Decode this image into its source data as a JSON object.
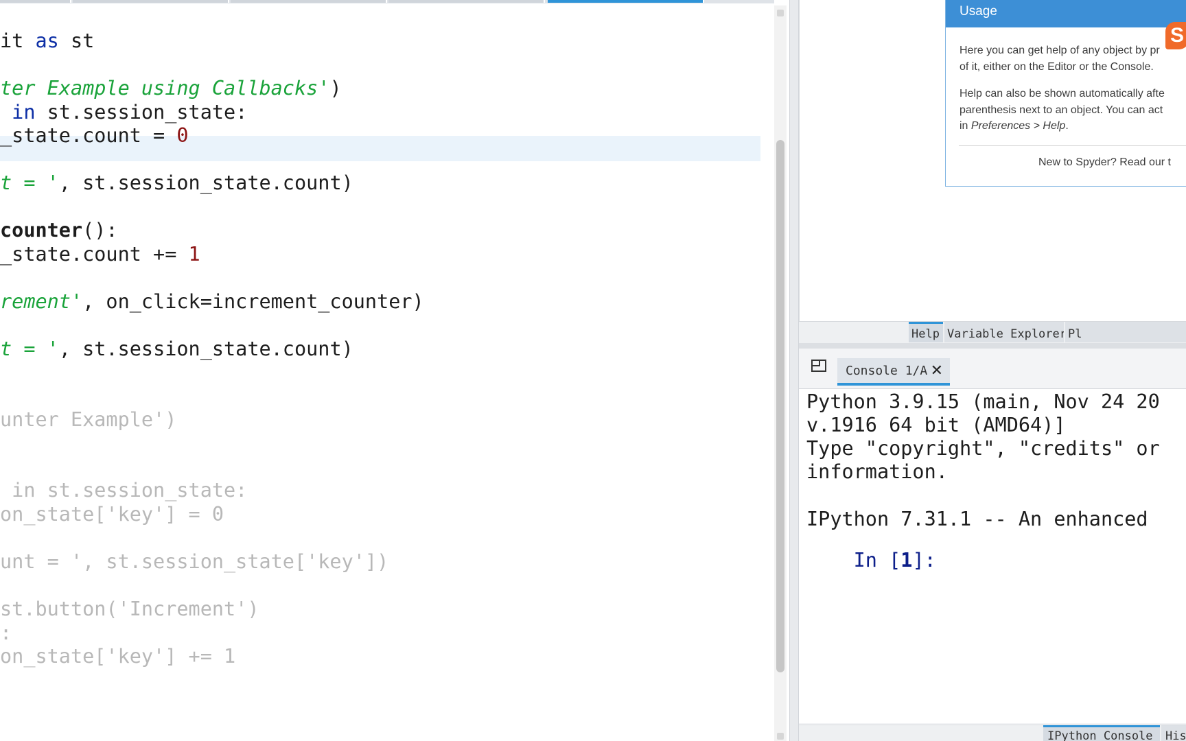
{
  "editor": {
    "lines": [
      {
        "id": "l1",
        "parts": [
          [
            "it ",
            ""
          ],
          [
            "as",
            "kw"
          ],
          [
            " st",
            ""
          ]
        ]
      },
      {
        "id": "l2",
        "parts": [
          [
            "ter Example using Callbacks'",
            "str"
          ],
          [
            ")",
            ""
          ]
        ]
      },
      {
        "id": "l3",
        "parts": [
          [
            " ",
            ""
          ],
          [
            "in",
            "kw"
          ],
          [
            " st.session_state:",
            ""
          ]
        ]
      },
      {
        "id": "l4",
        "parts": [
          [
            "_state.count = ",
            ""
          ],
          [
            "0",
            "num"
          ]
        ]
      },
      {
        "id": "l5",
        "parts": [
          [
            "t = '",
            "str"
          ],
          [
            ", st.session_state.count)",
            ""
          ]
        ]
      },
      {
        "id": "l6",
        "parts": [
          [
            "counter",
            "fn"
          ],
          [
            "():",
            ""
          ]
        ]
      },
      {
        "id": "l7",
        "parts": [
          [
            "_state.count += ",
            ""
          ],
          [
            "1",
            "num"
          ]
        ]
      },
      {
        "id": "l8",
        "parts": [
          [
            "rement'",
            "str"
          ],
          [
            ", on_click=increment_counter)",
            ""
          ]
        ]
      },
      {
        "id": "l9",
        "parts": [
          [
            "t = '",
            "str"
          ],
          [
            ", st.session_state.count)",
            ""
          ]
        ]
      },
      {
        "id": "l10",
        "parts": [
          [
            "unter Example')",
            "dim"
          ]
        ]
      },
      {
        "id": "l11",
        "parts": [
          [
            " in st.session_state:",
            "dim"
          ]
        ]
      },
      {
        "id": "l12",
        "parts": [
          [
            "on_state['key'] = 0",
            "dim"
          ]
        ]
      },
      {
        "id": "l13",
        "parts": [
          [
            "unt = ', st.session_state['key'])",
            "dim"
          ]
        ]
      },
      {
        "id": "l14",
        "parts": [
          [
            "st.button('Increment')",
            "dim"
          ]
        ]
      },
      {
        "id": "l15",
        "parts": [
          [
            ":",
            "dim"
          ]
        ]
      },
      {
        "id": "l16",
        "parts": [
          [
            "on_state['key'] += 1",
            "dim"
          ]
        ]
      }
    ]
  },
  "help": {
    "usage_title": "Usage",
    "para1_line1": "Here you can get help of any object by pr",
    "para1_line2": "of it, either on the Editor or the Console.",
    "para2_line1": "Help can also be shown automatically afte",
    "para2_line2": "parenthesis next to an object. You can act",
    "para2_line3_prefix": "in ",
    "para2_line3_italic": "Preferences > Help",
    "para2_line3_suffix": ".",
    "footer": "New to Spyder? Read our t",
    "brand_letter": "S",
    "tabs": [
      "Help",
      "Variable Explorer",
      "Pl"
    ]
  },
  "console": {
    "tab_label": "Console 1/A",
    "close_glyph": "✕",
    "lines": [
      "Python 3.9.15 (main, Nov 24 20",
      "v.1916 64 bit (AMD64)]",
      "Type \"copyright\", \"credits\" or",
      "information.",
      "",
      "IPython 7.31.1 -- An enhanced"
    ],
    "prompt_prefix": "In [",
    "prompt_number": "1",
    "prompt_suffix": "]:",
    "bottom_tabs": [
      "IPython Console",
      "His"
    ]
  }
}
